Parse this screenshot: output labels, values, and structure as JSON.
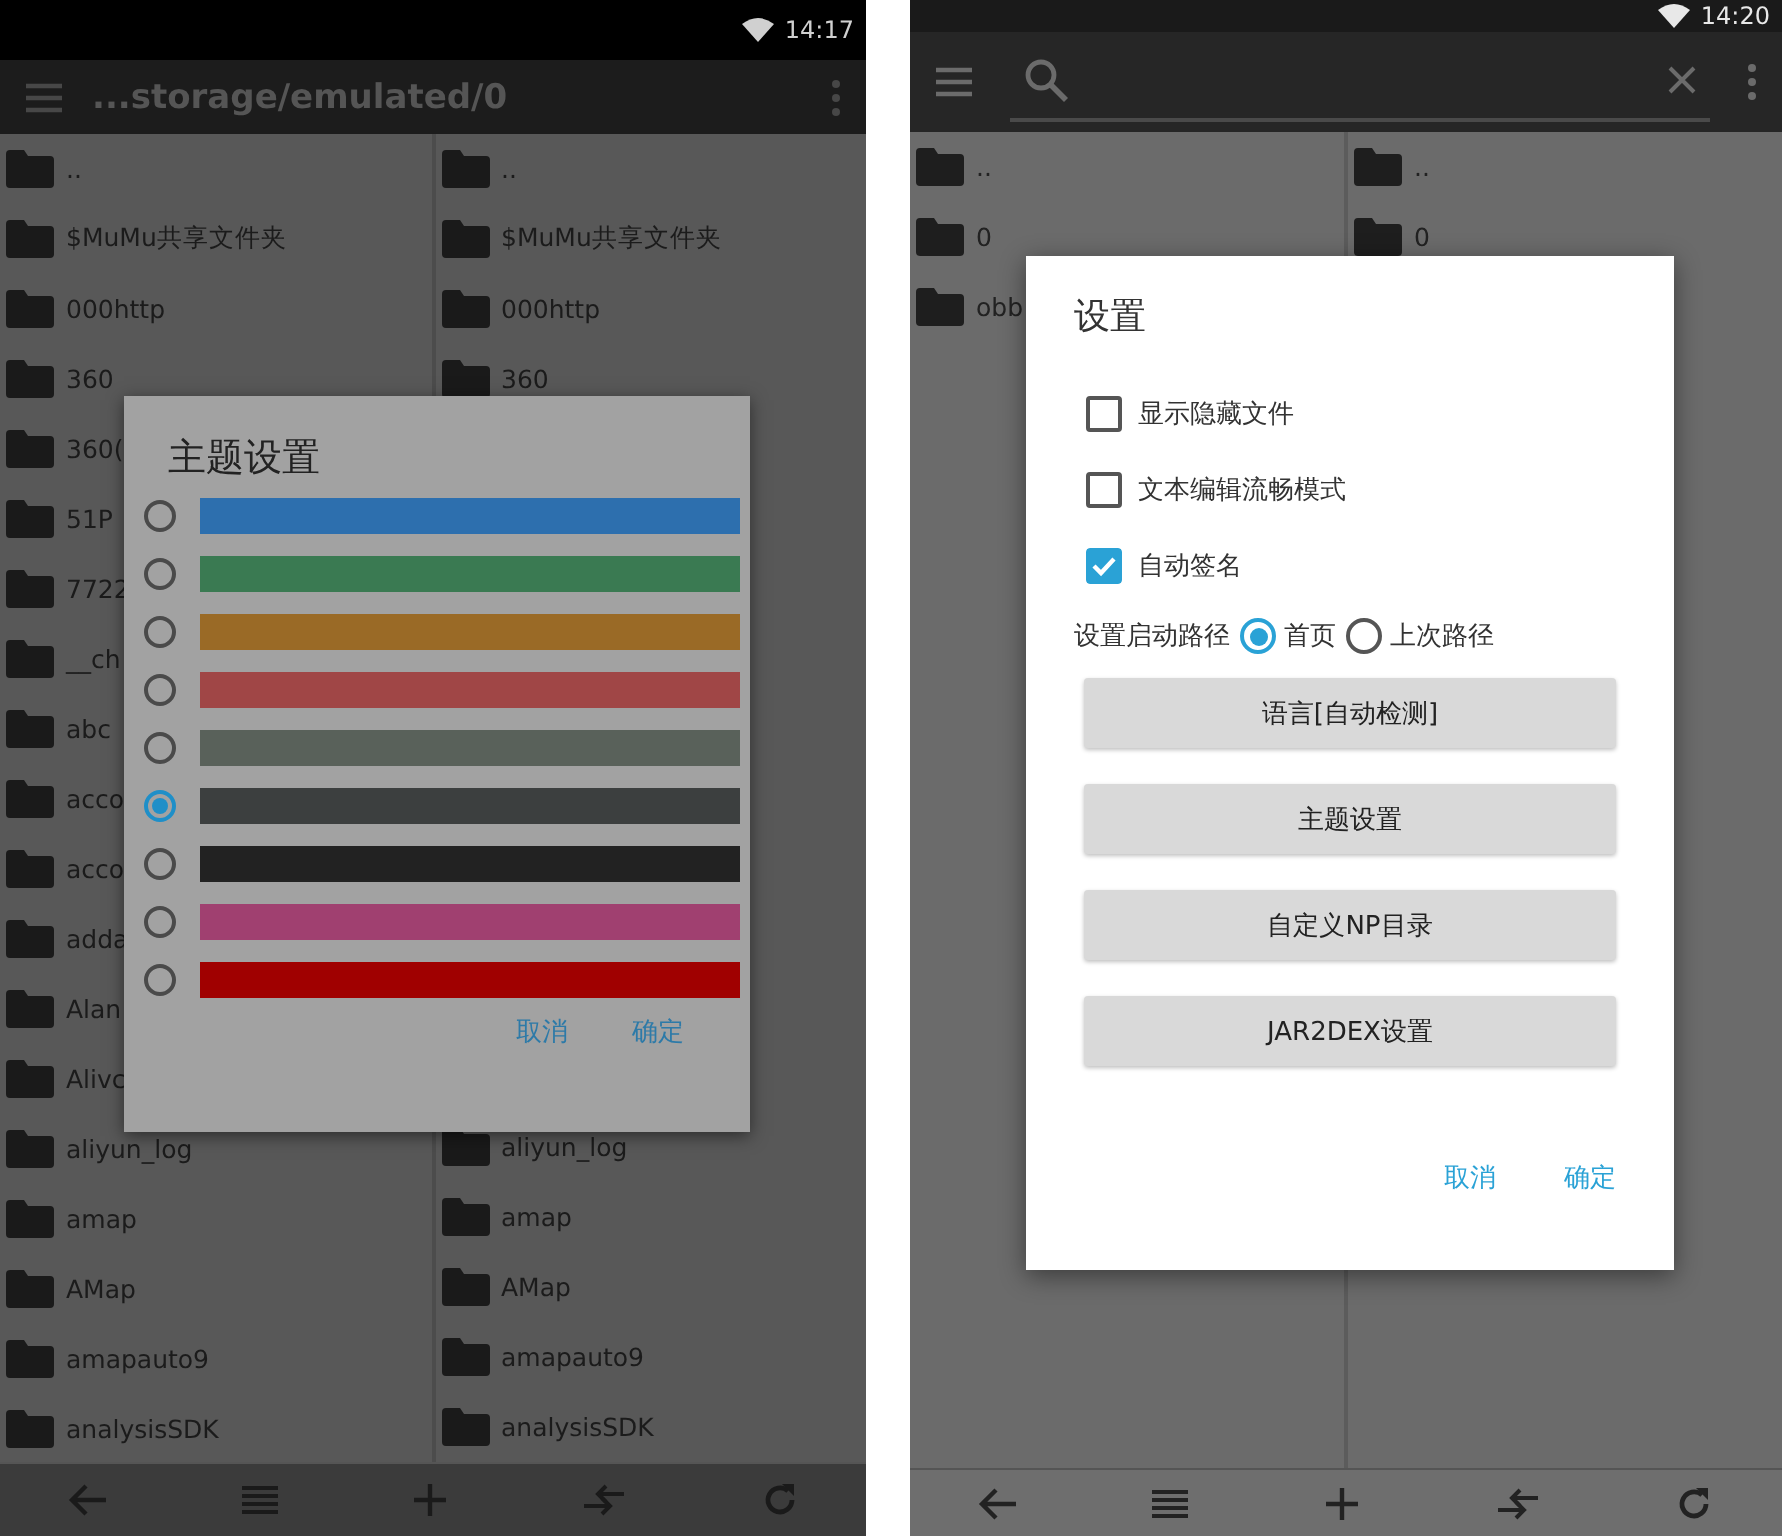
{
  "left_screen": {
    "status_bar": {
      "time": "14:17"
    },
    "toolbar": {
      "kind": "path",
      "title": "...storage/emulated/0"
    },
    "file_panes": [
      {
        "top_items": [
          {
            "name": ".."
          },
          {
            "name": "$MuMu共享文件夹"
          },
          {
            "name": "000http"
          },
          {
            "name": "360"
          },
          {
            "name": "360("
          },
          {
            "name": "51P"
          },
          {
            "name": "7722"
          },
          {
            "name": "__ch"
          },
          {
            "name": "abc"
          },
          {
            "name": "acco"
          },
          {
            "name": "acco"
          },
          {
            "name": "adda"
          },
          {
            "name": "Alan"
          },
          {
            "name": "Alivc"
          },
          {
            "name": "aliyun_log"
          },
          {
            "name": "amap"
          },
          {
            "name": "AMap"
          },
          {
            "name": "amapauto9"
          },
          {
            "name": "analysisSDK"
          }
        ]
      },
      {
        "top_items": [
          {
            "name": ".."
          },
          {
            "name": "$MuMu共享文件夹"
          },
          {
            "name": "000http"
          },
          {
            "name": "360"
          }
        ],
        "bottom_items": [
          {
            "name": "aliyun_log"
          },
          {
            "name": "amap"
          },
          {
            "name": "AMap"
          },
          {
            "name": "amapauto9"
          },
          {
            "name": "analysisSDK"
          }
        ]
      }
    ],
    "dialog": {
      "kind": "theme",
      "title": "主题设置",
      "options": [
        {
          "color": "#2d6fae",
          "selected": false
        },
        {
          "color": "#3a7a52",
          "selected": false
        },
        {
          "color": "#9a6a26",
          "selected": false
        },
        {
          "color": "#a04646",
          "selected": false
        },
        {
          "color": "#59615a",
          "selected": false
        },
        {
          "color": "#3c3f3f",
          "selected": true
        },
        {
          "color": "#222222",
          "selected": false
        },
        {
          "color": "#a04070",
          "selected": false
        },
        {
          "color": "#a00000",
          "selected": false
        }
      ],
      "buttons": [
        "取消",
        "确定"
      ]
    }
  },
  "right_screen": {
    "status_bar": {
      "time": "14:20"
    },
    "toolbar": {
      "kind": "search"
    },
    "file_panes": [
      {
        "top_items": [
          {
            "name": ".."
          },
          {
            "name": "0"
          },
          {
            "name": "obb"
          }
        ]
      },
      {
        "top_items": [
          {
            "name": ".."
          },
          {
            "name": "0"
          }
        ]
      }
    ],
    "dialog": {
      "kind": "settings",
      "title": "设置",
      "checkboxes": [
        {
          "label": "显示隐藏文件",
          "checked": false
        },
        {
          "label": "文本编辑流畅模式",
          "checked": false
        },
        {
          "label": "自动签名",
          "checked": true
        }
      ],
      "start_path": {
        "label": "设置启动路径",
        "options": [
          {
            "label": "首页",
            "selected": true
          },
          {
            "label": "上次路径",
            "selected": false
          }
        ]
      },
      "actions": [
        "语言[自动检测]",
        "主题设置",
        "自定义NP目录",
        "JAR2DEX设置"
      ],
      "buttons": [
        "取消",
        "确定"
      ]
    }
  }
}
